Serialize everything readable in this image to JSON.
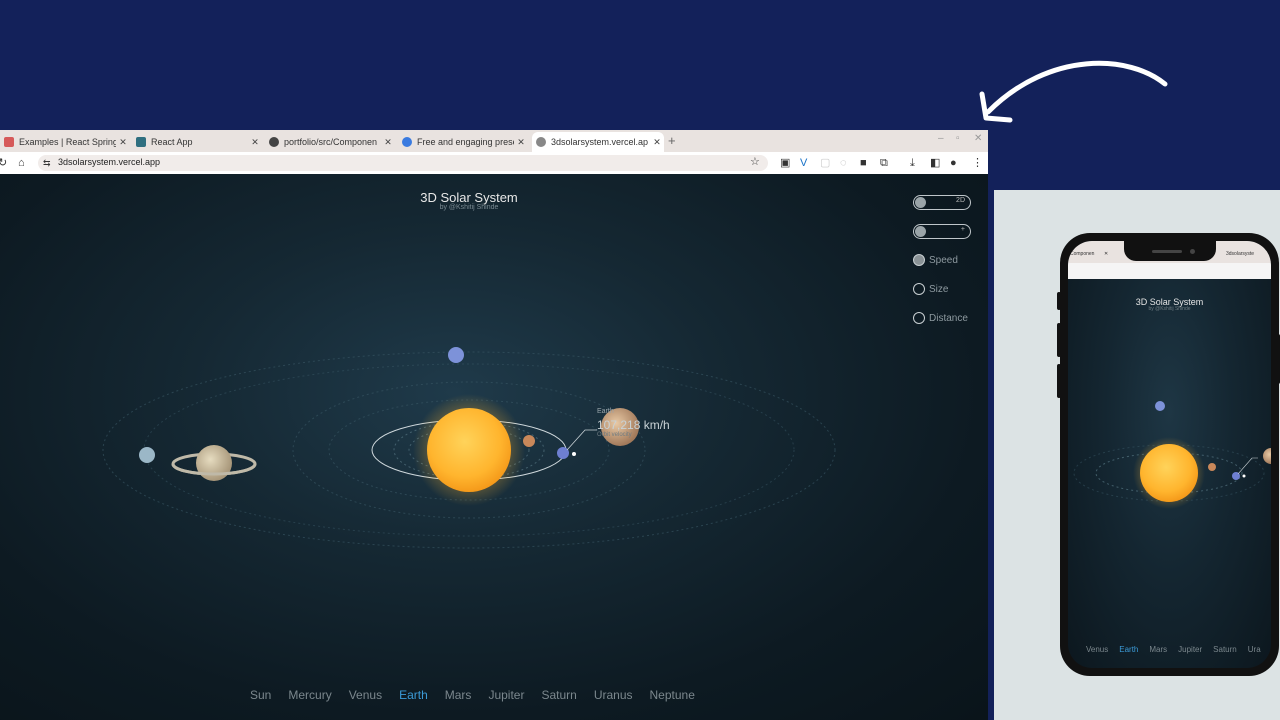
{
  "browser": {
    "tabs": [
      {
        "label": "Examples | React Spring",
        "favicon_color": "#d65a5a"
      },
      {
        "label": "React App",
        "favicon_color": "#2f6f80"
      },
      {
        "label": "portfolio/src/Componen",
        "favicon_color": "#444444"
      },
      {
        "label": "Free and engaging prese",
        "favicon_color": "#3a7be0"
      },
      {
        "label": "3dsolarsystem.vercel.ap",
        "favicon_color": "#888888",
        "active": true
      }
    ],
    "new_tab": "+",
    "url": "3dsolarsystem.vercel.app"
  },
  "site": {
    "title": "3D Solar System",
    "subtitle": "by @Kshitij Shinde",
    "toggle_view_label": "2D",
    "toggle_second_label": "+",
    "radio_speed": "Speed",
    "radio_size": "Size",
    "radio_distance": "Distance",
    "tooltip_name": "Earth",
    "tooltip_speed": "107,218 km/h",
    "tooltip_sub": "Orbit velocity",
    "nav": [
      "Sun",
      "Mercury",
      "Venus",
      "Earth",
      "Mars",
      "Jupiter",
      "Saturn",
      "Uranus",
      "Neptune"
    ],
    "nav_active": "Earth"
  },
  "phone": {
    "tab_left": "Componen",
    "tab_right": "3dsolarsyste",
    "title": "3D Solar System",
    "subtitle": "by @Kshitij Shinde",
    "nav": [
      "Venus",
      "Earth",
      "Mars",
      "Jupiter",
      "Saturn",
      "Ura"
    ],
    "nav_active": "Earth"
  },
  "colors": {
    "background": "#13215a",
    "sun": "#ffb52e",
    "active_nav": "#3b9ad6"
  }
}
